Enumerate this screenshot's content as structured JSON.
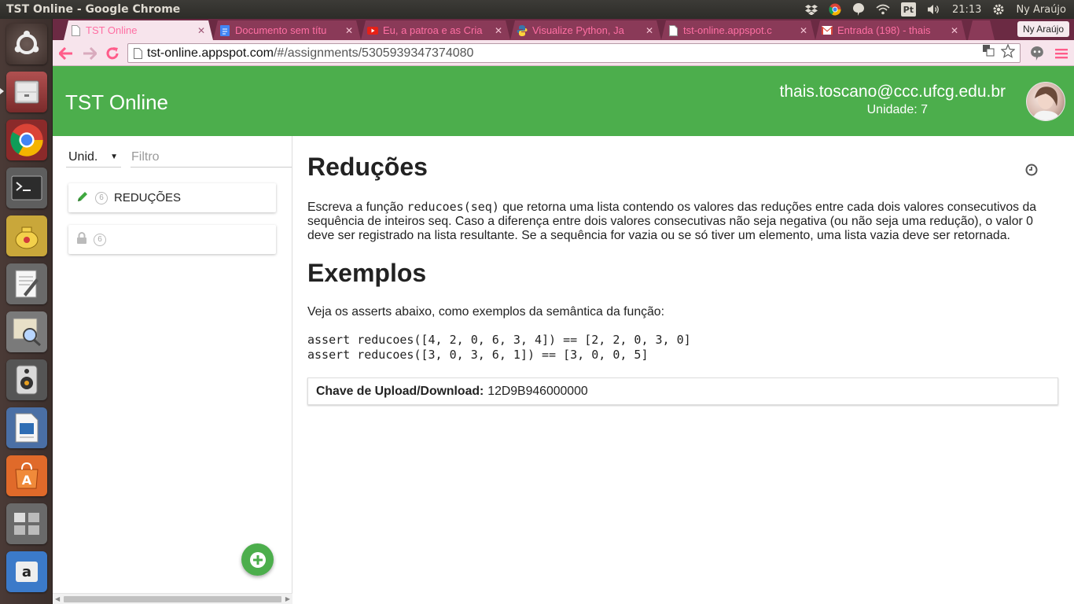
{
  "system": {
    "window_title": "TST Online - Google Chrome",
    "keyboard_layout": "Pt",
    "clock": "21:13",
    "user_name": "Ny Araújo"
  },
  "browser": {
    "tabs": [
      {
        "label": "TST Online",
        "icon": "document-icon",
        "active": true
      },
      {
        "label": "Documento sem títu",
        "icon": "google-docs-icon",
        "active": false
      },
      {
        "label": "Eu, a patroa e as Cria",
        "icon": "youtube-icon",
        "active": false
      },
      {
        "label": "Visualize Python, Ja",
        "icon": "python-icon",
        "active": false
      },
      {
        "label": "tst-online.appspot.c",
        "icon": "document-icon",
        "active": false
      },
      {
        "label": "Entrada (198) - thais",
        "icon": "gmail-icon",
        "active": false
      }
    ],
    "profile_label": "Ny Araújo",
    "url_host": "tst-online.appspot.com",
    "url_path": "/#/assignments/5305939347374080"
  },
  "app": {
    "title": "TST Online",
    "user_email": "thais.toscano@ccc.ufcg.edu.br",
    "unit_label": "Unidade: 7",
    "brand_color": "#4cae4c"
  },
  "sidebar": {
    "unit_select": "Unid.",
    "filter_placeholder": "Filtro",
    "assignments": [
      {
        "badge": "6",
        "label": "REDUÇÕES",
        "icon": "pencil-icon"
      },
      {
        "badge": "6",
        "label": "",
        "icon": "lock-icon"
      }
    ]
  },
  "content": {
    "title": "Reduções",
    "desc_prefix": "Escreva a função ",
    "desc_code": "reducoes(seq)",
    "desc_suffix": " que retorna uma lista contendo os valores das reduções entre cada dois valores consecutivos da sequência de inteiros seq. Caso a diferença entre dois valores consecutivas não seja negativa (ou não seja uma redução), o valor 0 deve ser registrado na lista resultante. Se a sequência for vazia ou se só tiver um elemento, uma lista vazia deve ser retornada.",
    "examples_title": "Exemplos",
    "examples_intro": "Veja os asserts abaixo, como exemplos da semântica da função:",
    "asserts": [
      "assert reducoes([4, 2, 0, 6, 3, 4]) == [2, 2, 0, 3, 0]",
      "assert reducoes([3, 0, 3, 6, 1]) == [3, 0, 0, 5]"
    ],
    "upload_label": "Chave de Upload/Download:",
    "upload_key": "12D9B946000000"
  }
}
